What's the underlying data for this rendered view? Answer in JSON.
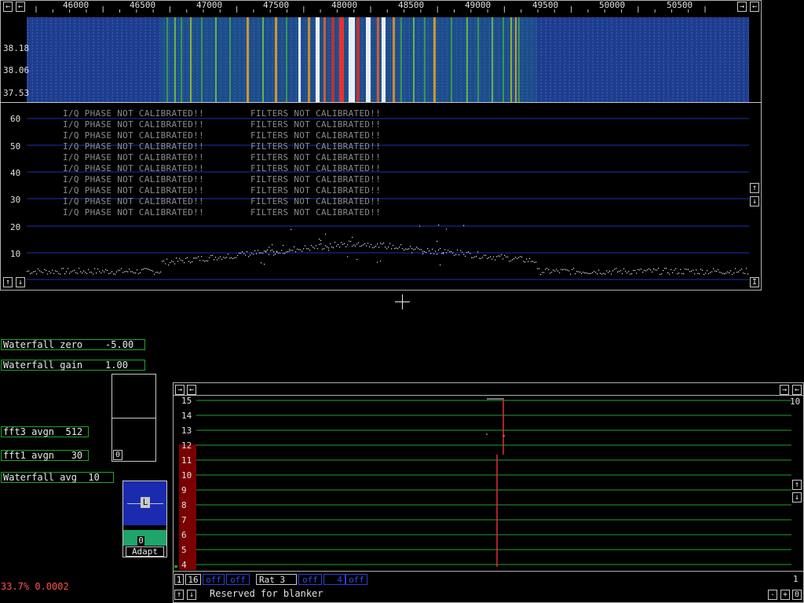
{
  "freq_axis": {
    "ticks": [
      "46000",
      "46500",
      "47000",
      "47500",
      "48000",
      "48500",
      "49000",
      "49500",
      "50000",
      "50500"
    ]
  },
  "waterfall": {
    "times": [
      "38.18",
      "38.06",
      "37.53"
    ]
  },
  "spectrum": {
    "ylabels": [
      "60",
      "50",
      "40",
      "30",
      "20",
      "10"
    ],
    "warning_phase": "I/Q PHASE NOT CALIBRATED!!",
    "warning_filters": "FILTERS NOT CALIBRATED!!"
  },
  "params": {
    "waterfall_zero": "Waterfall zero    -5.00",
    "waterfall_gain": "Waterfall gain    1.00",
    "fft3_avgn": "fft3 avgn  512",
    "fft1_avgn": "fft1 avgn   30",
    "waterfall_avg": "Waterfall avg  10"
  },
  "meter": {
    "zero_label": "0"
  },
  "agc_box": {
    "l_label": "L",
    "zero_label": "0",
    "adapt_label": "Adapt"
  },
  "status": {
    "cpu": "33.7% 0.0002"
  },
  "blanker": {
    "ylabels": [
      "15",
      "14",
      "13",
      "12",
      "11",
      "10",
      "9",
      "8",
      "7",
      "6",
      "5",
      "4"
    ],
    "right_top": "10",
    "right_bottom": "1",
    "btn_1": "1",
    "btn_16": "16",
    "btn_off1": "off",
    "btn_off2": "off",
    "btn_rat": "Rat   3",
    "btn_off3": "off",
    "btn_4": "4",
    "btn_off4": "off",
    "reserved": "Reserved for blanker",
    "minus": "-",
    "plus": "+",
    "zero": "0"
  },
  "icons": {
    "left_arrow": "←",
    "right_arrow": "→",
    "up_arrow": "↑",
    "down_arrow": "↓",
    "bar": "I"
  },
  "colors": {
    "grid_blue": "#1f2fb0",
    "grid_green": "#1fa52b",
    "waterfall_bg": "#1c3a8a",
    "dark_red": "#7a0000",
    "red_trace": "#e03030",
    "status_red": "#ff5050"
  }
}
